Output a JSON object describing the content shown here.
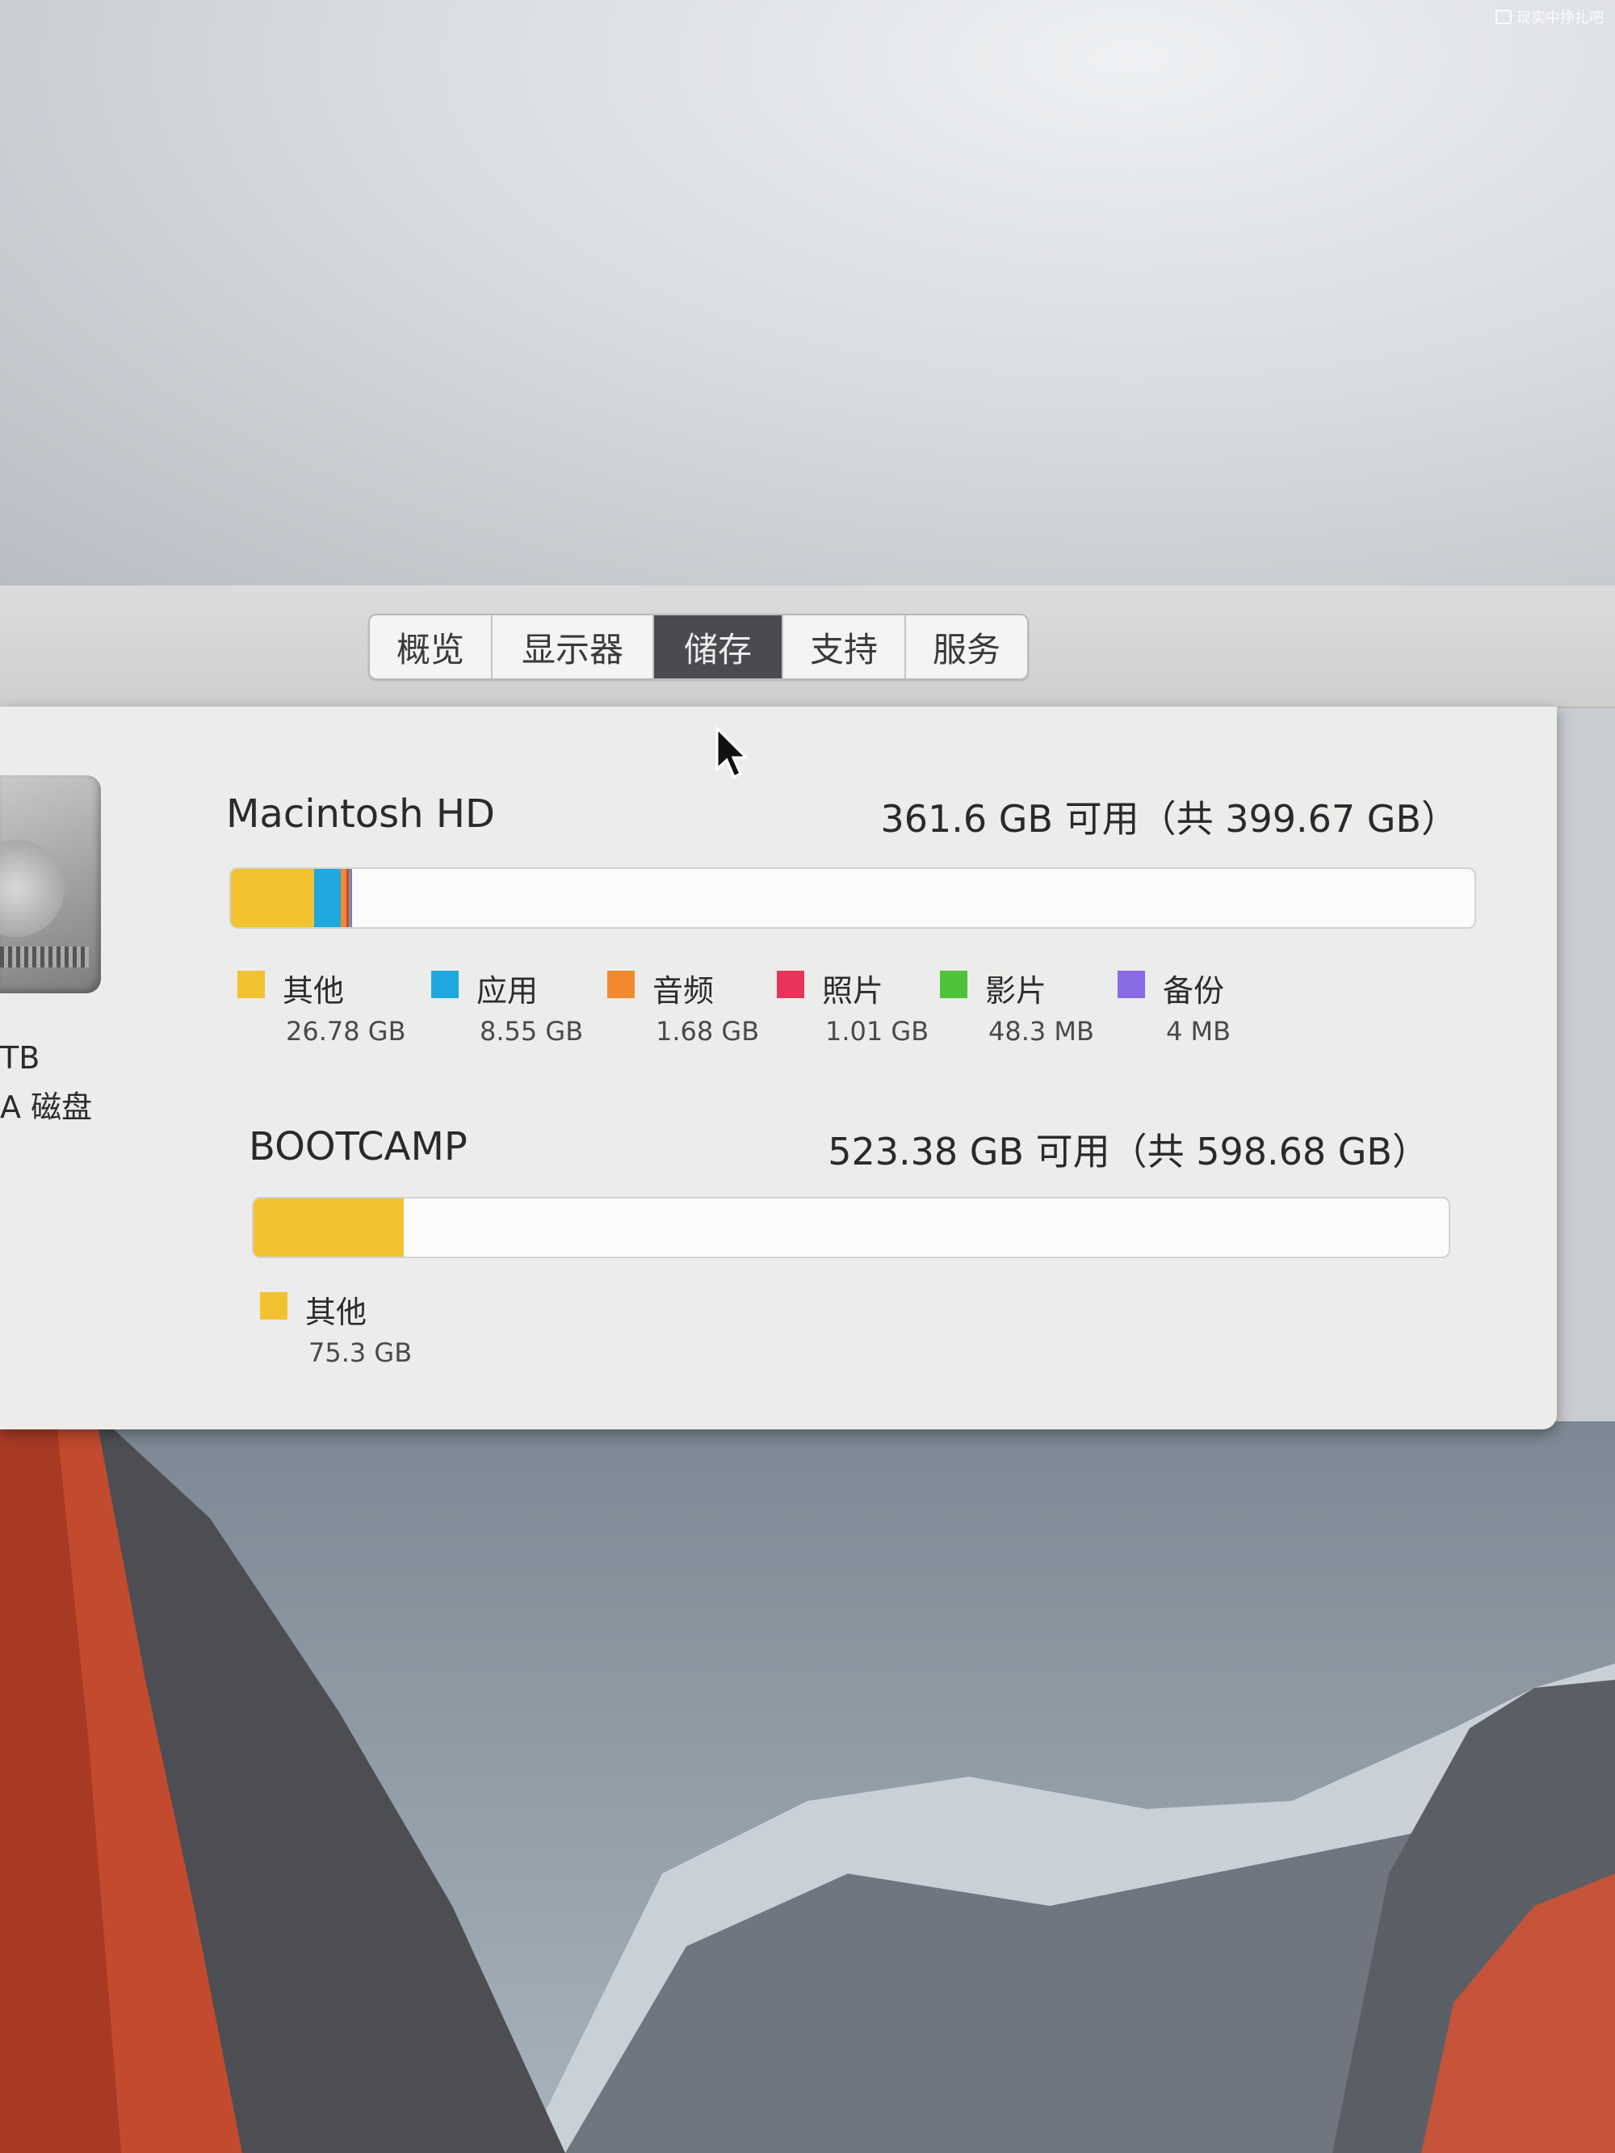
{
  "watermark": "现实中挣扎吧",
  "tabs": [
    {
      "label": "概览",
      "active": false
    },
    {
      "label": "显示器",
      "active": false
    },
    {
      "label": "储存",
      "active": true
    },
    {
      "label": "支持",
      "active": false
    },
    {
      "label": "服务",
      "active": false
    }
  ],
  "left_panel": {
    "caption_line1": "TB",
    "caption_line2": "A 磁盘"
  },
  "volumes": [
    {
      "name": "Macintosh HD",
      "free_text": "361.6 GB 可用（共 399.67 GB）",
      "total_gb": 399.67,
      "segments": [
        {
          "label": "其他",
          "size": "26.78 GB",
          "gb": 26.78,
          "color": "#f2c230"
        },
        {
          "label": "应用",
          "size": "8.55 GB",
          "gb": 8.55,
          "color": "#1fa7df"
        },
        {
          "label": "音频",
          "size": "1.68 GB",
          "gb": 1.68,
          "color": "#f08a2c"
        },
        {
          "label": "照片",
          "size": "1.01 GB",
          "gb": 1.01,
          "color": "#e8345a"
        },
        {
          "label": "影片",
          "size": "48.3 MB",
          "gb": 0.0483,
          "color": "#4fc13a"
        },
        {
          "label": "备份",
          "size": "4 MB",
          "gb": 0.004,
          "color": "#8a6be6"
        }
      ]
    },
    {
      "name": "BOOTCAMP",
      "free_text": "523.38 GB 可用（共 598.68 GB）",
      "total_gb": 598.68,
      "segments": [
        {
          "label": "其他",
          "size": "75.3 GB",
          "gb": 75.3,
          "color": "#f2c230"
        }
      ]
    }
  ]
}
